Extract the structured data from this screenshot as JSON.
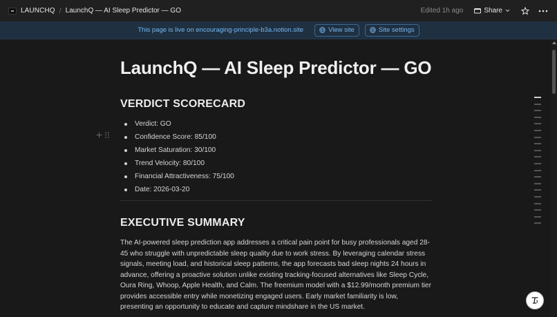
{
  "topbar": {
    "workspace": "LAUNCHQ",
    "separator": "/",
    "page_crumb": "LaunchQ — AI Sleep Predictor — GO",
    "edited": "Edited 1h ago",
    "share_label": "Share"
  },
  "banner": {
    "text": "This page is live on encouraging-principle-b3a.notion.site",
    "view_site": "View site",
    "site_settings": "Site settings"
  },
  "page": {
    "title": "LaunchQ — AI Sleep Predictor — GO",
    "scorecard_heading": "VERDICT SCORECARD",
    "scorecard_items": [
      "Verdict: GO",
      "Confidence Score: 85/100",
      "Market Saturation: 30/100",
      "Trend Velocity: 80/100",
      "Financial Attractiveness: 75/100",
      "Date: 2026-03-20"
    ],
    "summary_heading": "EXECUTIVE SUMMARY",
    "summary_text": "The AI-powered sleep prediction app addresses a critical pain point for busy professionals aged 28-45 who struggle with unpredictable sleep quality due to work stress. By leveraging calendar stress signals, meeting load, and historical sleep patterns, the app forecasts bad sleep nights 24 hours in advance, offering a proactive solution unlike existing tracking-focused alternatives like Sleep Cycle, Oura Ring, Whoop, Apple Health, and Calm. The freemium model with a $12.99/month premium tier provides accessible entry while monetizing engaged users. Early market familiarity is low, presenting an opportunity to educate and capture mindshare in the US market."
  },
  "icons": {
    "workspace": "workspace-logo-icon",
    "share_chevron": "chevron-down-icon",
    "favorite": "star-icon",
    "more": "more-horizontal-icon",
    "globe": "globe-icon",
    "add_block": "plus-icon",
    "drag": "drag-handle-icon",
    "help": "help-icon"
  },
  "colors": {
    "background": "#191919",
    "topbar": "#202020",
    "banner_bg": "#1f3041",
    "banner_accent": "#76b7f0"
  }
}
